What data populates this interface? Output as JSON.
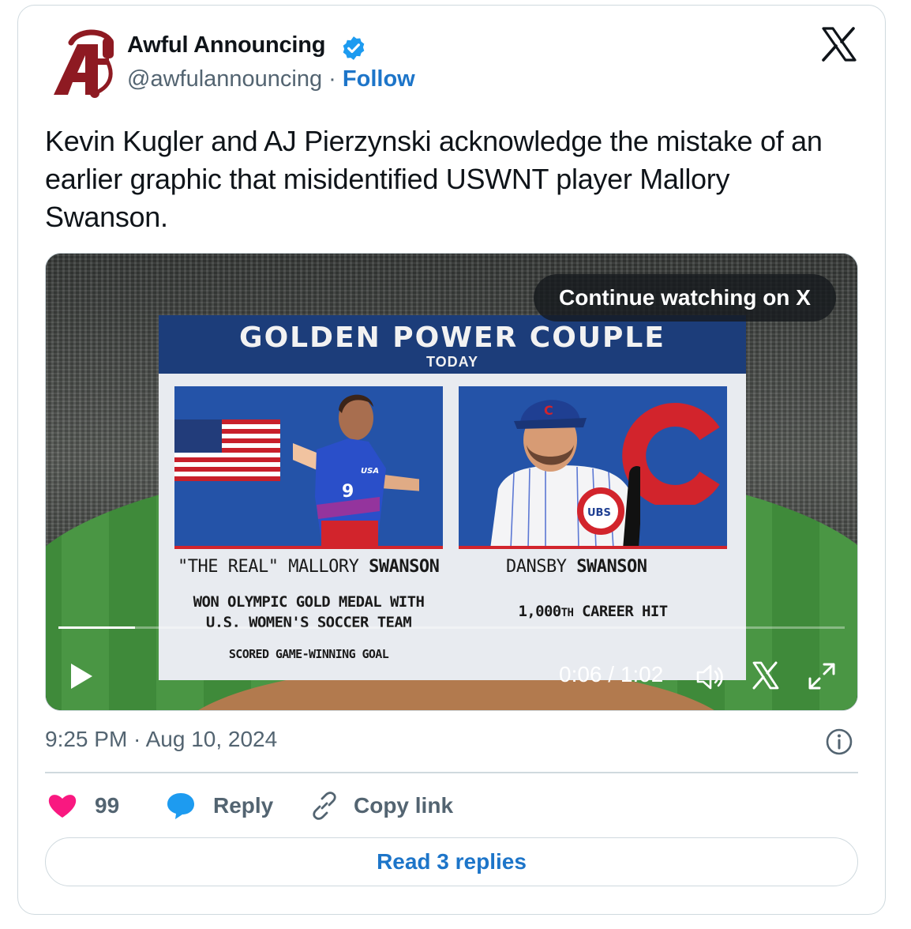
{
  "account": {
    "name": "Awful Announcing",
    "handle": "@awfulannouncing",
    "separator": "·",
    "follow_label": "Follow",
    "verified": true
  },
  "tweet": {
    "text": "Kevin Kugler and AJ Pierzynski acknowledge the mistake of an earlier graphic that misidentified USWNT player Mallory Swanson.",
    "timestamp": "9:25 PM · Aug 10, 2024"
  },
  "video": {
    "graphic": {
      "title": "GOLDEN POWER COUPLE",
      "subtitle": "TODAY",
      "left": {
        "name_prefix": "\"THE REAL\" MALLORY ",
        "name_bold": "SWANSON",
        "stat_line1": "WON OLYMPIC GOLD MEDAL WITH",
        "stat_line2": "U.S. WOMEN'S SOCCER TEAM",
        "stat_small": "SCORED GAME-WINNING GOAL",
        "jersey_number": "9",
        "jersey_text": "USA"
      },
      "right": {
        "name_prefix": "DANSBY ",
        "name_bold": "SWANSON",
        "stat_prefix": "1,000",
        "stat_sup": "TH",
        "stat_suffix": " CAREER HIT",
        "logo_text": "UBS"
      }
    },
    "continue_label": "Continue watching on X",
    "time": "0:06 / 1:02",
    "progress": 0.097
  },
  "actions": {
    "likes": "99",
    "reply_label": "Reply",
    "copy_label": "Copy link",
    "read_replies_label": "Read 3 replies"
  },
  "icons": {
    "like": "heart-icon",
    "reply": "speech-bubble-icon",
    "copy": "link-icon",
    "info": "info-icon",
    "brand": "x-logo-icon"
  },
  "colors": {
    "like": "#f91880",
    "reply": "#1d9bf0",
    "link": "#1d75c9",
    "verified": "#1d9bf0",
    "secondary_text": "#536471"
  }
}
